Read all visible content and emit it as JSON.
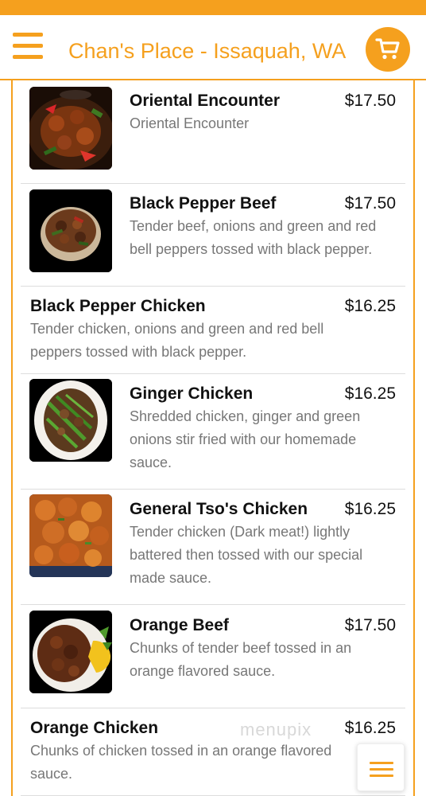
{
  "header": {
    "title": "Chan's Place - Issaquah, WA",
    "menu_icon": "hamburger-menu-icon",
    "cart_icon": "shopping-cart-icon"
  },
  "theme": {
    "accent": "#f5a01e",
    "text": "#111111",
    "muted": "#777777"
  },
  "menu_items": [
    {
      "name": "Oriental Encounter",
      "price": "$17.50",
      "description": "Oriental Encounter",
      "has_photo": true
    },
    {
      "name": "Black Pepper Beef",
      "price": "$17.50",
      "description": "Tender beef, onions and green and red bell peppers tossed with black pepper.",
      "has_photo": true
    },
    {
      "name": "Black Pepper Chicken",
      "price": "$16.25",
      "description": "Tender chicken, onions and green and red bell peppers tossed with black pepper.",
      "has_photo": false
    },
    {
      "name": "Ginger Chicken",
      "price": "$16.25",
      "description": "Shredded chicken, ginger and green onions stir fried with our homemade sauce.",
      "has_photo": true
    },
    {
      "name": "General Tso's Chicken",
      "price": "$16.25",
      "description": "Tender chicken (Dark meat!) lightly battered then tossed with our special made sauce.",
      "has_photo": true
    },
    {
      "name": "Orange Beef",
      "price": "$17.50",
      "description": "Chunks of tender beef tossed in an orange flavored sauce.",
      "has_photo": true
    },
    {
      "name": "Orange Chicken",
      "price": "$16.25",
      "description": "Chunks of chicken tossed in an orange flavored sauce.",
      "has_photo": false
    }
  ],
  "watermark": "menupix",
  "fab": {
    "icon": "menu-icon"
  }
}
